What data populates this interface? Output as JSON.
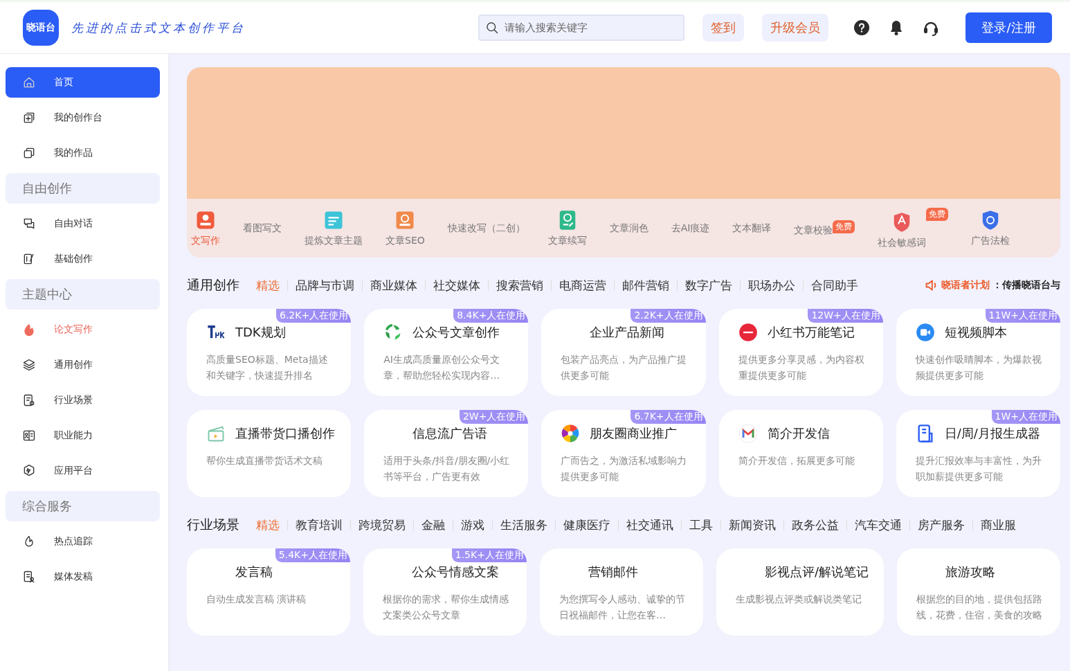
{
  "header": {
    "logo": "晓语台",
    "slogan": "先进的点击式文本创作平台",
    "search": {
      "placeholder": "请输入搜索关键字"
    },
    "checkin": "签到",
    "upgrade": "升级会员",
    "login": "登录/注册"
  },
  "sidebar": {
    "items": [
      {
        "kind": "item",
        "label": "首页",
        "selected": true,
        "hot": false
      },
      {
        "kind": "item",
        "label": "我的创作台",
        "selected": false,
        "hot": false
      },
      {
        "kind": "item",
        "label": "我的作品",
        "selected": false,
        "hot": false
      },
      {
        "kind": "section",
        "label": "自由创作"
      },
      {
        "kind": "item",
        "label": "自由对话",
        "selected": false,
        "hot": false
      },
      {
        "kind": "item",
        "label": "基础创作",
        "selected": false,
        "hot": false
      },
      {
        "kind": "section",
        "label": "主题中心"
      },
      {
        "kind": "item",
        "label": "论文写作",
        "selected": false,
        "hot": true
      },
      {
        "kind": "item",
        "label": "通用创作",
        "selected": false,
        "hot": false
      },
      {
        "kind": "item",
        "label": "行业场景",
        "selected": false,
        "hot": false
      },
      {
        "kind": "item",
        "label": "职业能力",
        "selected": false,
        "hot": false
      },
      {
        "kind": "item",
        "label": "应用平台",
        "selected": false,
        "hot": false
      },
      {
        "kind": "section",
        "label": "综合服务"
      },
      {
        "kind": "item",
        "label": "热点追踪",
        "selected": false,
        "hot": false
      },
      {
        "kind": "item",
        "label": "媒体发稿",
        "selected": false,
        "hot": false
      }
    ]
  },
  "tools": [
    {
      "label": "文写作",
      "hot": true
    },
    {
      "label": "看图写文",
      "hot": false
    },
    {
      "label": "提炼文章主题",
      "hot": false
    },
    {
      "label": "文章SEO",
      "hot": false
    },
    {
      "label": "快速改写（二创）",
      "hot": false
    },
    {
      "label": "文章续写",
      "hot": false
    },
    {
      "label": "文章润色",
      "hot": false
    },
    {
      "label": "去AI痕迹",
      "hot": false
    },
    {
      "label": "文本翻译",
      "hot": false
    },
    {
      "label": "文章校验",
      "hot": false,
      "badge": "免费"
    },
    {
      "label": "社会敏感词",
      "hot": false,
      "badge": "免费"
    },
    {
      "label": "广告法检",
      "hot": false
    }
  ],
  "sections": [
    {
      "title": "通用创作",
      "tabs": [
        {
          "label": "精选",
          "selected": true
        },
        {
          "label": "品牌与市调",
          "selected": false
        },
        {
          "label": "商业媒体",
          "selected": false
        },
        {
          "label": "社交媒体",
          "selected": false
        },
        {
          "label": "搜索营销",
          "selected": false
        },
        {
          "label": "电商运营",
          "selected": false
        },
        {
          "label": "邮件营销",
          "selected": false
        },
        {
          "label": "数字广告",
          "selected": false
        },
        {
          "label": "职场办公",
          "selected": false
        },
        {
          "label": "合同助手",
          "selected": false
        }
      ],
      "promo": {
        "label": "晓语者计划",
        "text": "：传播晓语台与"
      },
      "cards": [
        {
          "title": "TDK规划",
          "desc": "高质量SEO标题、Meta描述和关键字，快速提升排名",
          "usage": "6.2K+人在使用"
        },
        {
          "title": "公众号文章创作",
          "desc": "AI生成高质量原创公众号文章，帮助您轻松实现内容…",
          "usage": "8.4K+人在使用"
        },
        {
          "title": "企业产品新闻",
          "desc": "包装产品亮点，为产品推广提供更多可能",
          "usage": "2.2K+人在使用"
        },
        {
          "title": "小红书万能笔记",
          "desc": "提供更多分享灵感，为内容权重提供更多可能",
          "usage": "12W+人在使用"
        },
        {
          "title": "短视频脚本",
          "desc": "快速创作吸睛脚本，为爆款视频提供更多可能",
          "usage": "11W+人在使用"
        },
        {
          "title": "直播带货口播创作",
          "desc": "帮你生成直播带货话术文稿"
        },
        {
          "title": "信息流广告语",
          "desc": "适用于头条/抖音/朋友圈/小红书等平台，广告更有效",
          "usage": "2W+人在使用"
        },
        {
          "title": "朋友圈商业推广",
          "desc": "广而告之，为激活私域影响力提供更多可能",
          "usage": "6.7K+人在使用"
        },
        {
          "title": "简介开发信",
          "desc": "简介开发信，拓展更多可能"
        },
        {
          "title": "日/周/月报生成器",
          "desc": "提升汇报效率与丰富性，为升职加薪提供更多可能",
          "usage": "1W+人在使用"
        }
      ]
    },
    {
      "title": "行业场景",
      "tabs": [
        {
          "label": "精选",
          "selected": true
        },
        {
          "label": "教育培训",
          "selected": false
        },
        {
          "label": "跨境贸易",
          "selected": false
        },
        {
          "label": "金融",
          "selected": false
        },
        {
          "label": "游戏",
          "selected": false
        },
        {
          "label": "生活服务",
          "selected": false
        },
        {
          "label": "健康医疗",
          "selected": false
        },
        {
          "label": "社交通讯",
          "selected": false
        },
        {
          "label": "工具",
          "selected": false
        },
        {
          "label": "新闻资讯",
          "selected": false
        },
        {
          "label": "政务公益",
          "selected": false
        },
        {
          "label": "汽车交通",
          "selected": false
        },
        {
          "label": "房产服务",
          "selected": false
        },
        {
          "label": "商业服",
          "selected": false
        }
      ],
      "cards": [
        {
          "title": "发言稿",
          "desc": "自动生成发言稿 演讲稿",
          "usage": "5.4K+人在使用"
        },
        {
          "title": "公众号情感文案",
          "desc": "根据你的需求，帮你生成情感文案类公众号文章",
          "usage": "1.5K+人在使用"
        },
        {
          "title": "营销邮件",
          "desc": "为您撰写令人感动、诚挚的节日祝福邮件，让您在客…"
        },
        {
          "title": "影视点评/解说笔记",
          "desc": "生成影视点评类或解说类笔记"
        },
        {
          "title": "旅游攻略",
          "desc": "根据您的目的地，提供包括路线，花费，住宿，美食的攻略"
        }
      ]
    }
  ]
}
